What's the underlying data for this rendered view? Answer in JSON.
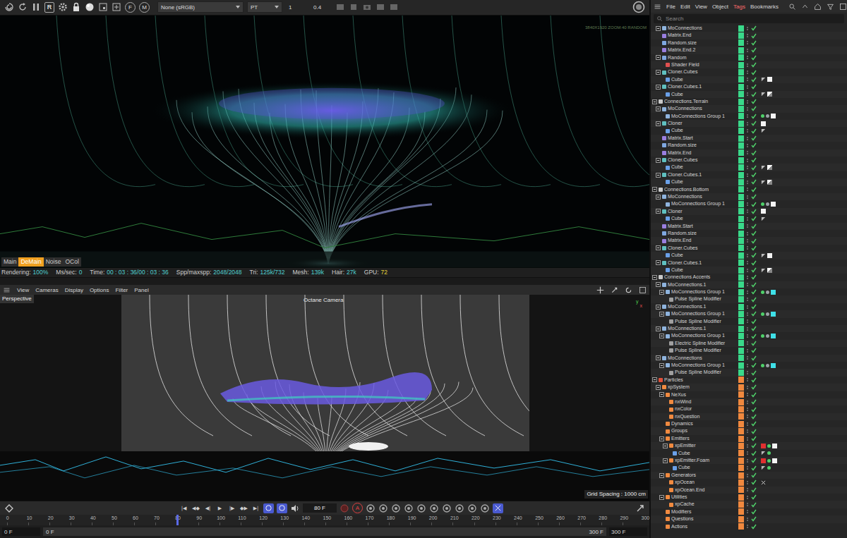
{
  "octane_toolbar": {
    "render_letter": "R",
    "letter_buttons": [
      "F",
      "M"
    ],
    "color_space": "None (sRGB)",
    "kernel": "PT",
    "value_a": "1",
    "value_b": "0.4"
  },
  "render": {
    "overlay": "3840X1920 ZOOM:40 RANDOM",
    "passes": [
      {
        "label": "Main",
        "selected": false
      },
      {
        "label": "DeMain",
        "selected": true
      },
      {
        "label": "Noise",
        "selected": false
      },
      {
        "label": "OCol",
        "selected": false
      }
    ]
  },
  "status": [
    {
      "label": "Rendering:",
      "value": "100%",
      "color": "#4fd0d0"
    },
    {
      "label": "Ms/sec:",
      "value": "0",
      "color": "#4fd0d0"
    },
    {
      "label": "Time:",
      "value": "00 : 03 : 36/00 : 03 : 36",
      "color": "#4fd0d0"
    },
    {
      "label": "Spp/maxspp:",
      "value": "2048/2048",
      "color": "#4fd0d0"
    },
    {
      "label": "Tri:",
      "value": "125k/732",
      "color": "#4fd0d0"
    },
    {
      "label": "Mesh:",
      "value": "139k",
      "color": "#4fd0d0"
    },
    {
      "label": "Hair:",
      "value": "27k",
      "color": "#4fd0d0"
    },
    {
      "label": "GPU:",
      "value": "72",
      "color": "#e6d23a"
    }
  ],
  "viewport": {
    "menu": [
      "View",
      "Cameras",
      "Display",
      "Options",
      "Filter",
      "Panel"
    ],
    "label": "Perspective",
    "camera": "Octane Camera",
    "grid": "Grid Spacing : 1000 cm",
    "axes": [
      "y",
      "x"
    ]
  },
  "timeline": {
    "transport": [
      "|◀",
      "◀◆",
      "◀|",
      "▶",
      "|▶",
      "◆▶",
      "▶|"
    ],
    "toggles": [
      {
        "kind": "loop",
        "selected": true
      },
      {
        "kind": "mode",
        "selected": true
      }
    ],
    "frame": "80 F",
    "autokey": "A",
    "ruler": [
      "0",
      "10",
      "20",
      "30",
      "40",
      "50",
      "60",
      "70",
      "80",
      "90",
      "100",
      "110",
      "120",
      "130",
      "140",
      "150",
      "160",
      "170",
      "180",
      "190",
      "200",
      "210",
      "220",
      "230",
      "240",
      "250",
      "260",
      "270",
      "280",
      "290",
      "300"
    ],
    "playhead": 0.2667,
    "range": {
      "start": "0 F",
      "min": "0 F",
      "max": "300 F",
      "end": "300 F"
    }
  },
  "object_manager": {
    "menu": [
      {
        "label": "File",
        "selected": false
      },
      {
        "label": "Edit",
        "selected": false
      },
      {
        "label": "View",
        "selected": false
      },
      {
        "label": "Object",
        "selected": false
      },
      {
        "label": "Tags",
        "selected": true
      },
      {
        "label": "Bookmarks",
        "selected": false
      }
    ],
    "search": {
      "placeholder": "Search"
    },
    "rows": [
      {
        "name": "MoConnections",
        "depth": 1,
        "kind": "mograph",
        "expandable": true,
        "expanded": true,
        "color": "#39d98a",
        "enabled": true,
        "tags": []
      },
      {
        "name": "Matrix.End",
        "depth": 1,
        "kind": "matrix",
        "expandable": false,
        "expanded": false,
        "color": "#39d98a",
        "enabled": true,
        "tags": []
      },
      {
        "name": "Random.size",
        "depth": 1,
        "kind": "effector",
        "expandable": false,
        "expanded": false,
        "color": "#39d98a",
        "enabled": true,
        "tags": []
      },
      {
        "name": "Matrix.End.2",
        "depth": 1,
        "kind": "matrix",
        "expandable": false,
        "expanded": false,
        "color": "#39d98a",
        "enabled": true,
        "tags": []
      },
      {
        "name": "Random",
        "depth": 1,
        "kind": "effector",
        "expandable": true,
        "expanded": true,
        "color": "#39d98a",
        "enabled": true,
        "tags": []
      },
      {
        "name": "Shader Field",
        "depth": 2,
        "kind": "field",
        "expandable": false,
        "expanded": false,
        "color": "#39d98a",
        "enabled": true,
        "tags": []
      },
      {
        "name": "Cloner.Cubes",
        "depth": 1,
        "kind": "cloner",
        "expandable": true,
        "expanded": true,
        "color": "#39d98a",
        "enabled": true,
        "tags": []
      },
      {
        "name": "Cube",
        "depth": 2,
        "kind": "cube",
        "expandable": false,
        "expanded": false,
        "color": "#39d98a",
        "enabled": true,
        "tags": [
          "flag",
          "white"
        ]
      },
      {
        "name": "Cloner.Cubes.1",
        "depth": 1,
        "kind": "cloner",
        "expandable": true,
        "expanded": true,
        "color": "#39d98a",
        "enabled": true,
        "tags": []
      },
      {
        "name": "Cube",
        "depth": 2,
        "kind": "cube",
        "expandable": false,
        "expanded": false,
        "color": "#39d98a",
        "enabled": true,
        "tags": [
          "flag",
          "checker"
        ]
      },
      {
        "name": "Connections.Terrain",
        "depth": 0,
        "kind": "null",
        "expandable": true,
        "expanded": true,
        "color": "#39d98a",
        "enabled": true,
        "tags": []
      },
      {
        "name": "MoConnections",
        "depth": 1,
        "kind": "mograph",
        "expandable": true,
        "expanded": true,
        "color": "#39d98a",
        "enabled": true,
        "tags": []
      },
      {
        "name": "MoConnections Group 1",
        "depth": 2,
        "kind": "mograph",
        "expandable": false,
        "expanded": false,
        "color": "#39d98a",
        "enabled": true,
        "tags": [
          "dot",
          "share",
          "white"
        ]
      },
      {
        "name": "Cloner",
        "depth": 1,
        "kind": "cloner",
        "expandable": true,
        "expanded": true,
        "color": "#39d98a",
        "enabled": true,
        "tags": [
          "white"
        ]
      },
      {
        "name": "Cube",
        "depth": 2,
        "kind": "cube",
        "expandable": false,
        "expanded": false,
        "color": "#39d98a",
        "enabled": true,
        "tags": [
          "flag"
        ]
      },
      {
        "name": "Matrix.Start",
        "depth": 1,
        "kind": "matrix",
        "expandable": false,
        "expanded": false,
        "color": "#39d98a",
        "enabled": true,
        "tags": []
      },
      {
        "name": "Random.size",
        "depth": 1,
        "kind": "effector",
        "expandable": false,
        "expanded": false,
        "color": "#39d98a",
        "enabled": true,
        "tags": []
      },
      {
        "name": "Matrix.End",
        "depth": 1,
        "kind": "matrix",
        "expandable": false,
        "expanded": false,
        "color": "#39d98a",
        "enabled": true,
        "tags": []
      },
      {
        "name": "Cloner.Cubes",
        "depth": 1,
        "kind": "cloner",
        "expandable": true,
        "expanded": true,
        "color": "#39d98a",
        "enabled": true,
        "tags": []
      },
      {
        "name": "Cube",
        "depth": 2,
        "kind": "cube",
        "expandable": false,
        "expanded": false,
        "color": "#39d98a",
        "enabled": true,
        "tags": [
          "flag",
          "checker"
        ]
      },
      {
        "name": "Cloner.Cubes.1",
        "depth": 1,
        "kind": "cloner",
        "expandable": true,
        "expanded": true,
        "color": "#39d98a",
        "enabled": true,
        "tags": []
      },
      {
        "name": "Cube",
        "depth": 2,
        "kind": "cube",
        "expandable": false,
        "expanded": false,
        "color": "#39d98a",
        "enabled": true,
        "tags": [
          "flag",
          "checker"
        ]
      },
      {
        "name": "Connections.Bottom",
        "depth": 0,
        "kind": "null",
        "expandable": true,
        "expanded": true,
        "color": "#39d98a",
        "enabled": true,
        "tags": []
      },
      {
        "name": "MoConnections",
        "depth": 1,
        "kind": "mograph",
        "expandable": true,
        "expanded": true,
        "color": "#39d98a",
        "enabled": true,
        "tags": []
      },
      {
        "name": "MoConnections Group 1",
        "depth": 2,
        "kind": "mograph",
        "expandable": false,
        "expanded": false,
        "color": "#39d98a",
        "enabled": true,
        "tags": [
          "dot",
          "share",
          "white"
        ]
      },
      {
        "name": "Cloner",
        "depth": 1,
        "kind": "cloner",
        "expandable": true,
        "expanded": true,
        "color": "#39d98a",
        "enabled": true,
        "tags": [
          "white"
        ]
      },
      {
        "name": "Cube",
        "depth": 2,
        "kind": "cube",
        "expandable": false,
        "expanded": false,
        "color": "#39d98a",
        "enabled": true,
        "tags": [
          "flag"
        ]
      },
      {
        "name": "Matrix.Start",
        "depth": 1,
        "kind": "matrix",
        "expandable": false,
        "expanded": false,
        "color": "#39d98a",
        "enabled": true,
        "tags": []
      },
      {
        "name": "Random.size",
        "depth": 1,
        "kind": "effector",
        "expandable": false,
        "expanded": false,
        "color": "#39d98a",
        "enabled": true,
        "tags": []
      },
      {
        "name": "Matrix.End",
        "depth": 1,
        "kind": "matrix",
        "expandable": false,
        "expanded": false,
        "color": "#39d98a",
        "enabled": true,
        "tags": []
      },
      {
        "name": "Cloner.Cubes",
        "depth": 1,
        "kind": "cloner",
        "expandable": true,
        "expanded": true,
        "color": "#39d98a",
        "enabled": true,
        "tags": []
      },
      {
        "name": "Cube",
        "depth": 2,
        "kind": "cube",
        "expandable": false,
        "expanded": false,
        "color": "#39d98a",
        "enabled": true,
        "tags": [
          "flag",
          "white"
        ]
      },
      {
        "name": "Cloner.Cubes.1",
        "depth": 1,
        "kind": "cloner",
        "expandable": true,
        "expanded": true,
        "color": "#39d98a",
        "enabled": true,
        "tags": []
      },
      {
        "name": "Cube",
        "depth": 2,
        "kind": "cube",
        "expandable": false,
        "expanded": false,
        "color": "#39d98a",
        "enabled": true,
        "tags": [
          "flag",
          "checker"
        ]
      },
      {
        "name": "Connections Accents",
        "depth": 0,
        "kind": "null",
        "expandable": true,
        "expanded": true,
        "color": "#39d98a",
        "enabled": true,
        "tags": []
      },
      {
        "name": "MoConnections.1",
        "depth": 1,
        "kind": "mograph",
        "expandable": true,
        "expanded": true,
        "color": "#39d98a",
        "enabled": true,
        "tags": []
      },
      {
        "name": "MoConnections Group 1",
        "depth": 2,
        "kind": "mograph",
        "expandable": true,
        "expanded": true,
        "color": "#39d98a",
        "enabled": true,
        "tags": [
          "dot",
          "share",
          "cyan"
        ]
      },
      {
        "name": "Pulse Spline Modifier",
        "depth": 3,
        "kind": "modifier",
        "expandable": false,
        "expanded": false,
        "color": "#39d98a",
        "enabled": true,
        "tags": []
      },
      {
        "name": "MoConnections.1",
        "depth": 1,
        "kind": "mograph",
        "expandable": true,
        "expanded": true,
        "color": "#39d98a",
        "enabled": true,
        "tags": []
      },
      {
        "name": "MoConnections Group 1",
        "depth": 2,
        "kind": "mograph",
        "expandable": true,
        "expanded": true,
        "color": "#39d98a",
        "enabled": true,
        "tags": [
          "dot",
          "share",
          "cyan"
        ]
      },
      {
        "name": "Pulse Spline Modifier",
        "depth": 3,
        "kind": "modifier",
        "expandable": false,
        "expanded": false,
        "color": "#39d98a",
        "enabled": true,
        "tags": []
      },
      {
        "name": "MoConnections.1",
        "depth": 1,
        "kind": "mograph",
        "expandable": true,
        "expanded": true,
        "color": "#39d98a",
        "enabled": true,
        "tags": []
      },
      {
        "name": "MoConnections Group 1",
        "depth": 2,
        "kind": "mograph",
        "expandable": true,
        "expanded": true,
        "color": "#39d98a",
        "enabled": true,
        "tags": [
          "dot",
          "share",
          "cyan"
        ]
      },
      {
        "name": "Electric Spline Modifier",
        "depth": 3,
        "kind": "modifier",
        "expandable": false,
        "expanded": false,
        "color": "#39d98a",
        "enabled": true,
        "tags": []
      },
      {
        "name": "Pulse Spline Modifier",
        "depth": 3,
        "kind": "modifier",
        "expandable": false,
        "expanded": false,
        "color": "#39d98a",
        "enabled": true,
        "tags": []
      },
      {
        "name": "MoConnections",
        "depth": 1,
        "kind": "mograph",
        "expandable": true,
        "expanded": true,
        "color": "#39d98a",
        "enabled": true,
        "tags": []
      },
      {
        "name": "MoConnections Group 1",
        "depth": 2,
        "kind": "mograph",
        "expandable": true,
        "expanded": true,
        "color": "#39d98a",
        "enabled": true,
        "tags": [
          "dot",
          "share",
          "cyan"
        ]
      },
      {
        "name": "Pulse Spline Modifier",
        "depth": 3,
        "kind": "modifier",
        "expandable": false,
        "expanded": false,
        "color": "#39d98a",
        "enabled": true,
        "tags": []
      },
      {
        "name": "Particles",
        "depth": 0,
        "kind": "folder",
        "expandable": true,
        "expanded": true,
        "color": "#f0883e",
        "enabled": true,
        "tags": []
      },
      {
        "name": "xpSystem",
        "depth": 1,
        "kind": "xp",
        "expandable": true,
        "expanded": true,
        "color": "#f0883e",
        "enabled": true,
        "tags": []
      },
      {
        "name": "NeXus",
        "depth": 2,
        "kind": "xp",
        "expandable": true,
        "expanded": true,
        "color": "#f0883e",
        "enabled": true,
        "tags": []
      },
      {
        "name": "nxWind",
        "depth": 3,
        "kind": "xp",
        "expandable": false,
        "expanded": false,
        "color": "#f0883e",
        "enabled": true,
        "tags": []
      },
      {
        "name": "nxColor",
        "depth": 3,
        "kind": "xp",
        "expandable": false,
        "expanded": false,
        "color": "#f0883e",
        "enabled": true,
        "tags": []
      },
      {
        "name": "nxQuestion",
        "depth": 3,
        "kind": "xp",
        "expandable": false,
        "expanded": false,
        "color": "#f0883e",
        "enabled": true,
        "tags": []
      },
      {
        "name": "Dynamics",
        "depth": 2,
        "kind": "xp",
        "expandable": false,
        "expanded": false,
        "color": "#f0883e",
        "enabled": true,
        "tags": []
      },
      {
        "name": "Groups",
        "depth": 2,
        "kind": "xp",
        "expandable": false,
        "expanded": false,
        "color": "#f0883e",
        "enabled": true,
        "tags": []
      },
      {
        "name": "Emitters",
        "depth": 2,
        "kind": "xp",
        "expandable": true,
        "expanded": true,
        "color": "#f0883e",
        "enabled": true,
        "tags": []
      },
      {
        "name": "xpEmitter",
        "depth": 3,
        "kind": "xp",
        "expandable": true,
        "expanded": true,
        "color": "#f0883e",
        "enabled": true,
        "tags": [
          "red",
          "dot",
          "white"
        ]
      },
      {
        "name": "Cube",
        "depth": 4,
        "kind": "cube",
        "expandable": false,
        "expanded": false,
        "color": "#f0883e",
        "enabled": true,
        "tags": [
          "flag",
          "dot"
        ]
      },
      {
        "name": "xpEmitter.Foam",
        "depth": 3,
        "kind": "xp",
        "expandable": true,
        "expanded": true,
        "color": "#f0883e",
        "enabled": true,
        "tags": [
          "red",
          "dot",
          "white"
        ]
      },
      {
        "name": "Cube",
        "depth": 4,
        "kind": "cube",
        "expandable": false,
        "expanded": false,
        "color": "#f0883e",
        "enabled": true,
        "tags": [
          "flag",
          "dot"
        ]
      },
      {
        "name": "Generators",
        "depth": 2,
        "kind": "xp",
        "expandable": true,
        "expanded": true,
        "color": "#f0883e",
        "enabled": true,
        "tags": []
      },
      {
        "name": "xpOcean",
        "depth": 3,
        "kind": "xp",
        "expandable": false,
        "expanded": false,
        "color": "#f0883e",
        "enabled": true,
        "tags": [
          "x"
        ]
      },
      {
        "name": "xpOcean.End",
        "depth": 3,
        "kind": "xp",
        "expandable": false,
        "expanded": false,
        "color": "#f0883e",
        "enabled": true,
        "tags": []
      },
      {
        "name": "Utilities",
        "depth": 2,
        "kind": "xp",
        "expandable": true,
        "expanded": true,
        "color": "#f0883e",
        "enabled": true,
        "tags": []
      },
      {
        "name": "xpCache",
        "depth": 3,
        "kind": "xp",
        "expandable": false,
        "expanded": false,
        "color": "#f0883e",
        "enabled": true,
        "tags": []
      },
      {
        "name": "Modifiers",
        "depth": 2,
        "kind": "xp",
        "expandable": false,
        "expanded": false,
        "color": "#f0883e",
        "enabled": true,
        "tags": []
      },
      {
        "name": "Questions",
        "depth": 2,
        "kind": "xp",
        "expandable": false,
        "expanded": false,
        "color": "#f0883e",
        "enabled": true,
        "tags": []
      },
      {
        "name": "Actions",
        "depth": 2,
        "kind": "xp",
        "expandable": false,
        "expanded": false,
        "color": "#f0883e",
        "enabled": true,
        "tags": []
      }
    ]
  }
}
